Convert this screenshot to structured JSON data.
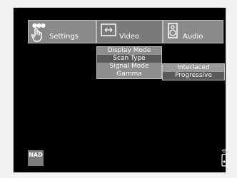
{
  "tabs": [
    {
      "label": "Settings",
      "icon": "hand-pointer-icon"
    },
    {
      "label": "Video",
      "icon": "video-screen-icon"
    },
    {
      "label": "Audio",
      "icon": "speaker-icon"
    }
  ],
  "video_menu": {
    "items": [
      "Display Mode",
      "Scan Type",
      "Signal Mode",
      "Gamma"
    ],
    "selected": "Scan Type"
  },
  "scan_type_options": {
    "items": [
      "Interlaced",
      "Progressive"
    ],
    "highlighted": "Interlaced"
  },
  "brand": {
    "logo_text": "NAD"
  },
  "colors": {
    "background": "#000000",
    "tab": "#8a8a8a",
    "selected": "#5a5a5a"
  }
}
